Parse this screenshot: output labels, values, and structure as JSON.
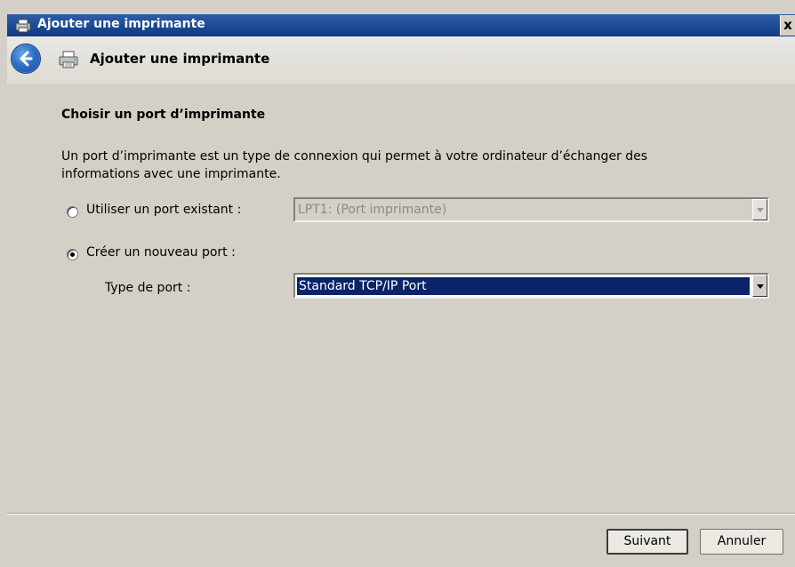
{
  "window": {
    "title": "Ajouter une imprimante",
    "close_label": "x"
  },
  "header": {
    "title": "Ajouter une imprimante",
    "back_icon": "back-arrow-icon",
    "printer_icon": "printer-icon"
  },
  "main": {
    "section_title": "Choisir un port d’imprimante",
    "description": "Un port d’imprimante est un type de connexion qui permet à votre ordinateur d’échanger des informations avec une imprimante.",
    "existing_port": {
      "label": "Utiliser un port existant :",
      "selected": false,
      "value": "LPT1: (Port imprimante)",
      "enabled": false
    },
    "new_port": {
      "label": "Créer un nouveau port :",
      "selected": true,
      "type_label": "Type de port :",
      "type_value": "Standard TCP/IP Port"
    }
  },
  "footer": {
    "next_label": "Suivant",
    "cancel_label": "Annuler"
  },
  "colors": {
    "title_bar": "#1b4a96",
    "selection": "#0a246a",
    "face": "#d4d0c8"
  }
}
